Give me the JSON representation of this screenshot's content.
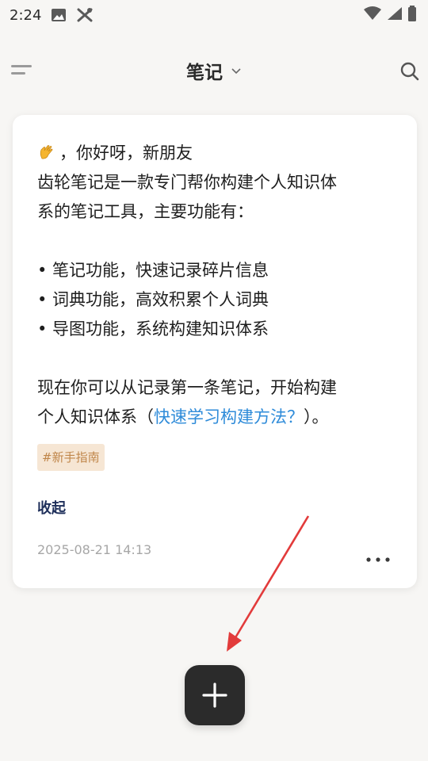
{
  "status_bar": {
    "time": "2:24",
    "icons": [
      "image-icon",
      "tools-icon",
      "wifi-icon",
      "signal-icon",
      "battery-icon"
    ]
  },
  "header": {
    "title": "笔记",
    "menu_icon": "menu-icon",
    "dropdown_icon": "chevron-down-icon",
    "search_icon": "search-icon"
  },
  "note": {
    "greeting": "，你好呀，新朋友",
    "intro_line1": "齿轮笔记是一款专门帮你构建个人知识体",
    "intro_line2": "系的笔记工具，主要功能有：",
    "bullet1": "• 笔记功能，快速记录碎片信息",
    "bullet2": "• 词典功能，高效积累个人词典",
    "bullet3": "• 导图功能，系统构建知识体系",
    "outro_line1": "现在你可以从记录第一条笔记，开始构建",
    "outro_line2_prefix": "个人知识体系（",
    "outro_link": "快速学习构建方法？",
    "outro_line2_suffix": "）。",
    "tag": "#新手指南",
    "collapse_label": "收起",
    "timestamp": "2025-08-21 14:13"
  },
  "colors": {
    "background": "#f7f6f4",
    "link": "#2e8bd9",
    "tag_bg": "#f6e6d4",
    "tag_text": "#c0864a",
    "annotation_arrow": "#e23b3b",
    "fab": "#2b2b2b"
  }
}
